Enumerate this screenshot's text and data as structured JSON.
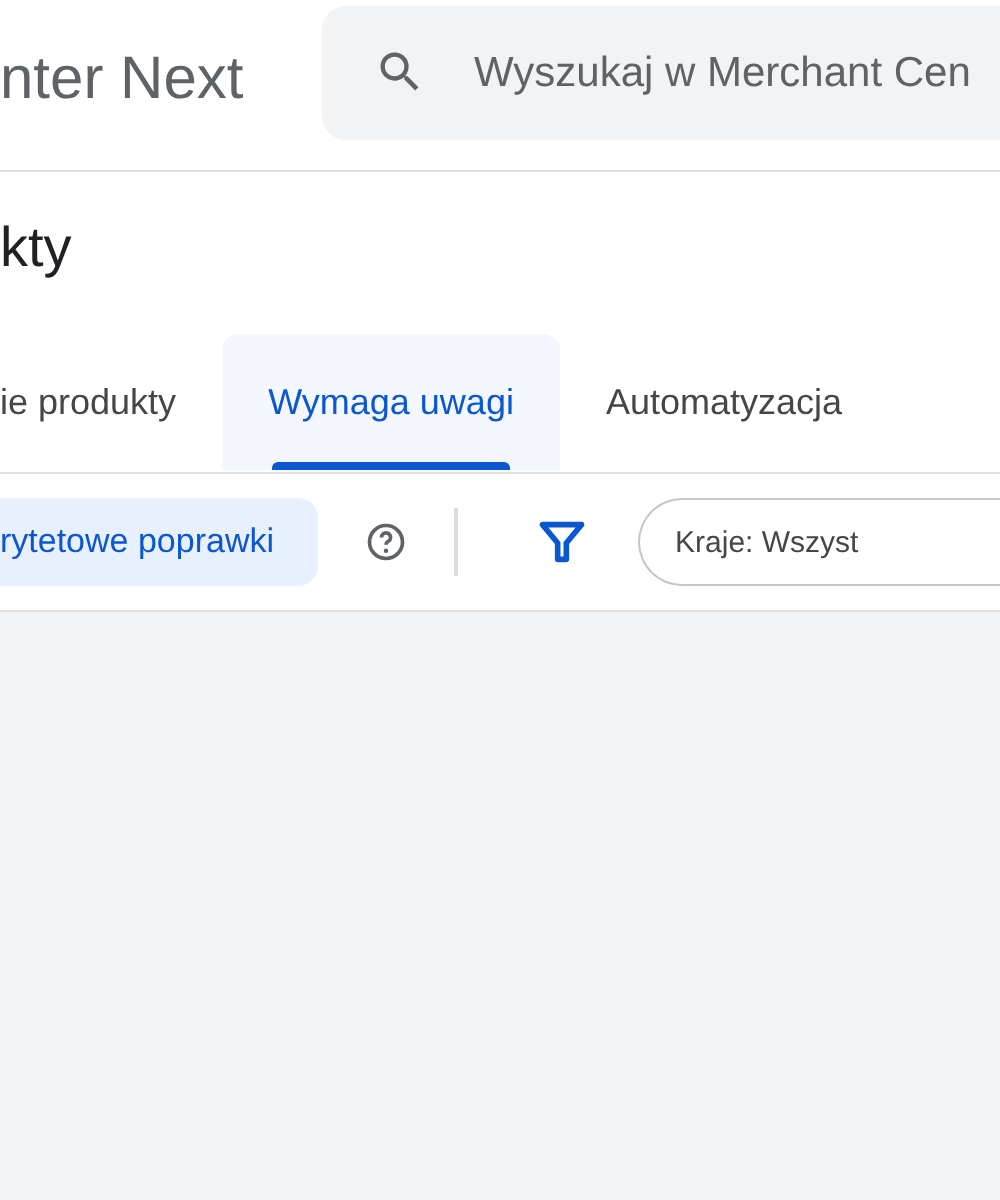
{
  "header": {
    "app_title": "nter Next",
    "search": {
      "placeholder": "Wyszukaj w Merchant Cen"
    }
  },
  "page_title": "kty",
  "tabs": [
    {
      "label": "ie produkty",
      "selected": false
    },
    {
      "label": "Wymaga uwagi",
      "selected": true
    },
    {
      "label": "Automatyzacja",
      "selected": false
    }
  ],
  "toolbar": {
    "priority_chip": {
      "label": "rytetowe poprawki",
      "selected": true
    },
    "country_filter": {
      "label": "Kraje: Wszyst"
    }
  }
}
